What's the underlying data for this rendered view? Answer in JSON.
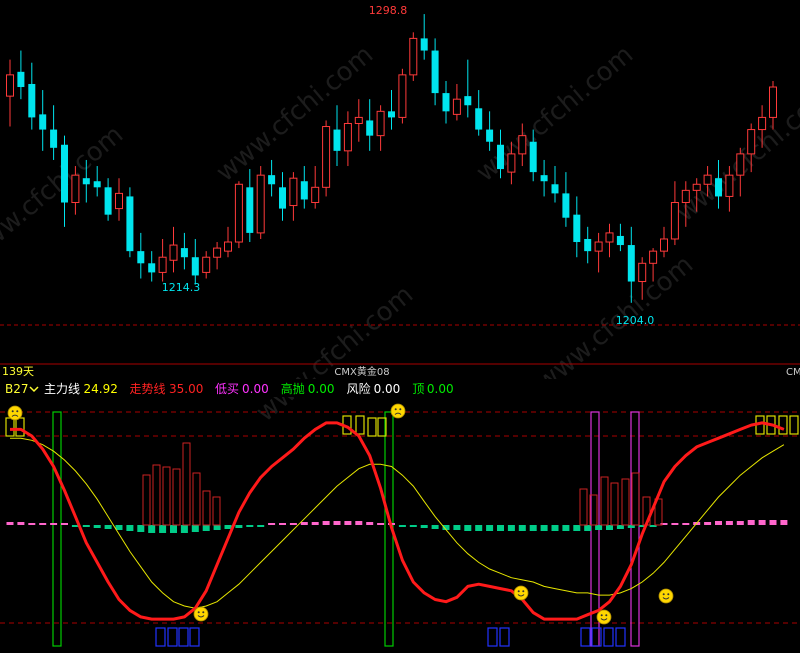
{
  "colors": {
    "background": "#000000",
    "bull": "#ff3a3a",
    "bear": "#00e5ee",
    "grid": "#a80000",
    "main_line": "#ff1a1a",
    "trend_line": "#e6e600",
    "bar_magenta": "#ff66cc",
    "bar_green": "#00cc88",
    "bar_red": "#cc2222",
    "bar_blue": "#2233ff",
    "box_green": "#00cc00",
    "box_magenta": "#dd33dd",
    "box_yellow": "#dddd00",
    "smiley": "#ffd700"
  },
  "icons": {
    "indicator_dropdown": "chevron-down-icon",
    "sell_marker": "sad-face-icon",
    "buy_marker": "smiley-face-icon"
  },
  "watermark": "www.cfchi.com",
  "price_panel": {
    "high_label": "1298.8",
    "low_label_1": "1214.3",
    "low_label_2": "1204.0",
    "period_label": "139天",
    "symbol_label": "CMX黄金08",
    "right_clipped_label": "CM"
  },
  "indicator_header": {
    "name": "B27",
    "items": [
      {
        "label": "主力线",
        "value": "24.92",
        "color": "#ffffff",
        "value_color": "#ffff00"
      },
      {
        "label": "走势线",
        "value": "35.00",
        "color": "#ff2222",
        "value_color": "#ff2222"
      },
      {
        "label": "低买",
        "value": "0.00",
        "color": "#ff33ff",
        "value_color": "#ff33ff"
      },
      {
        "label": "高抛",
        "value": "0.00",
        "color": "#00ee00",
        "value_color": "#00ee00"
      },
      {
        "label": "风险",
        "value": "0.00",
        "color": "#ffffff",
        "value_color": "#ffffff"
      },
      {
        "label": "顶",
        "value": "0.00",
        "color": "#00ee00",
        "value_color": "#00ee00"
      }
    ]
  },
  "chart_data": [
    {
      "type": "candlestick",
      "title": "CMX黄金08",
      "annotations": [
        "1298.8",
        "1214.3",
        "1204.0"
      ],
      "ohlc": [
        [
          1273,
          1285,
          1263,
          1280
        ],
        [
          1281,
          1288,
          1272,
          1276
        ],
        [
          1277,
          1284,
          1262,
          1266
        ],
        [
          1267,
          1275,
          1255,
          1262
        ],
        [
          1262,
          1270,
          1252,
          1256
        ],
        [
          1257,
          1260,
          1230,
          1238
        ],
        [
          1238,
          1250,
          1234,
          1247
        ],
        [
          1246,
          1252,
          1238,
          1244
        ],
        [
          1245,
          1250,
          1240,
          1243
        ],
        [
          1243,
          1246,
          1232,
          1234
        ],
        [
          1236,
          1246,
          1232,
          1241
        ],
        [
          1240,
          1243,
          1220,
          1222
        ],
        [
          1222,
          1228,
          1213,
          1218
        ],
        [
          1218,
          1222,
          1212,
          1215
        ],
        [
          1215,
          1226,
          1212,
          1220
        ],
        [
          1219,
          1230,
          1215,
          1224
        ],
        [
          1223,
          1228,
          1216,
          1220
        ],
        [
          1220,
          1226,
          1211,
          1214
        ],
        [
          1215,
          1222,
          1213,
          1220
        ],
        [
          1220,
          1225,
          1216,
          1223
        ],
        [
          1222,
          1230,
          1220,
          1225
        ],
        [
          1225,
          1245,
          1223,
          1244
        ],
        [
          1243,
          1249,
          1225,
          1228
        ],
        [
          1228,
          1250,
          1226,
          1247
        ],
        [
          1247,
          1252,
          1240,
          1244
        ],
        [
          1243,
          1248,
          1232,
          1236
        ],
        [
          1237,
          1248,
          1232,
          1246
        ],
        [
          1245,
          1250,
          1236,
          1239
        ],
        [
          1238,
          1250,
          1236,
          1243
        ],
        [
          1243,
          1265,
          1240,
          1263
        ],
        [
          1262,
          1270,
          1250,
          1255
        ],
        [
          1255,
          1268,
          1250,
          1264
        ],
        [
          1264,
          1272,
          1258,
          1266
        ],
        [
          1265,
          1272,
          1255,
          1260
        ],
        [
          1260,
          1270,
          1255,
          1268
        ],
        [
          1268,
          1275,
          1262,
          1266
        ],
        [
          1266,
          1282,
          1264,
          1280
        ],
        [
          1280,
          1294,
          1278,
          1292
        ],
        [
          1292,
          1300,
          1285,
          1288
        ],
        [
          1288,
          1292,
          1270,
          1274
        ],
        [
          1274,
          1278,
          1264,
          1268
        ],
        [
          1267,
          1277,
          1265,
          1272
        ],
        [
          1273,
          1285,
          1266,
          1270
        ],
        [
          1269,
          1275,
          1260,
          1262
        ],
        [
          1262,
          1268,
          1255,
          1258
        ],
        [
          1257,
          1262,
          1246,
          1249
        ],
        [
          1248,
          1258,
          1244,
          1254
        ],
        [
          1254,
          1264,
          1250,
          1260
        ],
        [
          1258,
          1262,
          1245,
          1248
        ],
        [
          1247,
          1252,
          1240,
          1245
        ],
        [
          1244,
          1250,
          1238,
          1241
        ],
        [
          1241,
          1248,
          1230,
          1233
        ],
        [
          1234,
          1240,
          1220,
          1225
        ],
        [
          1226,
          1230,
          1218,
          1222
        ],
        [
          1222,
          1228,
          1215,
          1225
        ],
        [
          1225,
          1231,
          1220,
          1228
        ],
        [
          1227,
          1231,
          1222,
          1224
        ],
        [
          1224,
          1230,
          1205,
          1212
        ],
        [
          1212,
          1220,
          1206,
          1218
        ],
        [
          1218,
          1223,
          1212,
          1222
        ],
        [
          1222,
          1230,
          1220,
          1226
        ],
        [
          1226,
          1245,
          1224,
          1238
        ],
        [
          1238,
          1245,
          1230,
          1242
        ],
        [
          1242,
          1246,
          1235,
          1244
        ],
        [
          1244,
          1250,
          1240,
          1247
        ],
        [
          1246,
          1252,
          1236,
          1240
        ],
        [
          1240,
          1250,
          1235,
          1247
        ],
        [
          1247,
          1256,
          1240,
          1254
        ],
        [
          1254,
          1264,
          1248,
          1262
        ],
        [
          1262,
          1270,
          1256,
          1266
        ],
        [
          1266,
          1278,
          1262,
          1276
        ]
      ]
    },
    {
      "type": "line",
      "title": "B27",
      "ylim": [
        0,
        100
      ],
      "series": [
        {
          "name": "走势线",
          "values": [
            92,
            92,
            89,
            83,
            75,
            64,
            52,
            40,
            31,
            22,
            14,
            9,
            6,
            5,
            5,
            5,
            6,
            10,
            18,
            30,
            42,
            54,
            63,
            70,
            75,
            79,
            83,
            88,
            92,
            95,
            95,
            93,
            89,
            80,
            65,
            47,
            32,
            22,
            17,
            14,
            13,
            15,
            20,
            21,
            20,
            19,
            18,
            14,
            8,
            5,
            5,
            5,
            5,
            7,
            9,
            13,
            20,
            30,
            44,
            56,
            68,
            75,
            80,
            84,
            86,
            88,
            90,
            92,
            94,
            95,
            94,
            92
          ]
        },
        {
          "name": "主力线",
          "values": [
            88,
            88,
            87,
            85,
            82,
            78,
            73,
            67,
            60,
            52,
            44,
            36,
            29,
            22,
            17,
            13,
            11,
            10,
            11,
            13,
            17,
            21,
            26,
            31,
            36,
            41,
            46,
            51,
            56,
            61,
            66,
            70,
            74,
            76,
            76,
            75,
            71,
            66,
            59,
            52,
            46,
            40,
            35,
            31,
            28,
            26,
            24,
            23,
            22,
            20,
            19,
            18,
            17,
            17,
            16,
            16,
            17,
            19,
            22,
            26,
            31,
            37,
            43,
            49,
            55,
            61,
            66,
            71,
            75,
            79,
            82,
            85
          ]
        }
      ]
    },
    {
      "type": "bar",
      "series": [
        {
          "name": "bars",
          "values": [
            0.3,
            0.3,
            0.2,
            0.2,
            0.1,
            0.0,
            -0.1,
            -0.2,
            -0.3,
            -0.4,
            -0.5,
            -0.6,
            -0.7,
            -0.8,
            -0.8,
            -0.8,
            -0.8,
            -0.7,
            -0.6,
            -0.5,
            -0.4,
            -0.3,
            -0.2,
            -0.1,
            0.0,
            0.1,
            0.2,
            0.3,
            0.3,
            0.4,
            0.4,
            0.4,
            0.4,
            0.3,
            0.2,
            0.1,
            -0.1,
            -0.2,
            -0.3,
            -0.4,
            -0.5,
            -0.5,
            -0.6,
            -0.6,
            -0.6,
            -0.6,
            -0.6,
            -0.6,
            -0.6,
            -0.6,
            -0.6,
            -0.6,
            -0.6,
            -0.6,
            -0.5,
            -0.5,
            -0.4,
            -0.3,
            -0.2,
            -0.1,
            0.0,
            0.1,
            0.2,
            0.3,
            0.3,
            0.4,
            0.4,
            0.4,
            0.5,
            0.5,
            0.5,
            0.5
          ]
        },
        {
          "name": "spikes",
          "values": [
            0,
            0,
            0,
            0,
            0,
            0,
            0,
            0,
            0,
            0,
            0,
            0,
            0,
            0,
            0,
            0,
            0,
            0,
            0,
            0,
            0,
            0,
            0,
            0,
            0,
            0,
            0,
            0,
            0,
            0,
            0,
            0,
            0,
            0,
            0,
            0,
            0,
            0,
            0,
            0,
            0,
            0,
            0,
            0,
            0,
            0,
            0,
            0,
            0,
            0,
            0,
            0,
            0,
            0,
            0,
            0,
            0,
            0,
            0,
            0,
            0,
            0,
            0,
            0,
            0,
            0,
            0,
            0,
            0,
            0,
            0,
            0
          ]
        }
      ]
    }
  ]
}
